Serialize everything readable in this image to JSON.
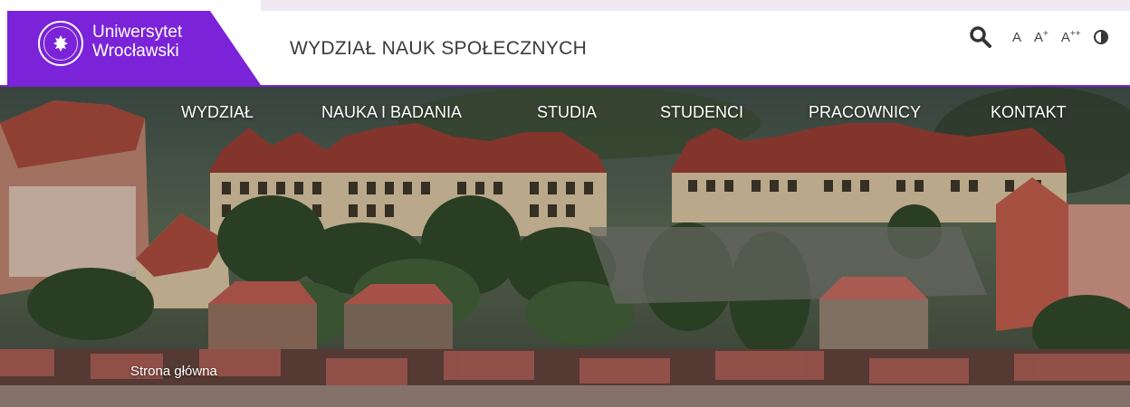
{
  "header": {
    "logo_line1": "Uniwersytet",
    "logo_line2": "Wrocławski",
    "faculty_title": "WYDZIAŁ NAUK SPOŁECZNYCH",
    "brand_color": "#7a23d8"
  },
  "tools": {
    "search_icon": "search-icon",
    "font_normal": "A",
    "font_large": "A",
    "font_large_sup": "+",
    "font_larger": "A",
    "font_larger_sup": "++",
    "contrast_icon": "contrast-icon"
  },
  "nav": {
    "items": [
      {
        "label": "WYDZIAŁ"
      },
      {
        "label": "NAUKA I BADANIA"
      },
      {
        "label": "STUDIA"
      },
      {
        "label": "STUDENCI"
      },
      {
        "label": "PRACOWNICY"
      },
      {
        "label": "KONTAKT"
      }
    ]
  },
  "breadcrumb": {
    "home": "Strona główna"
  }
}
